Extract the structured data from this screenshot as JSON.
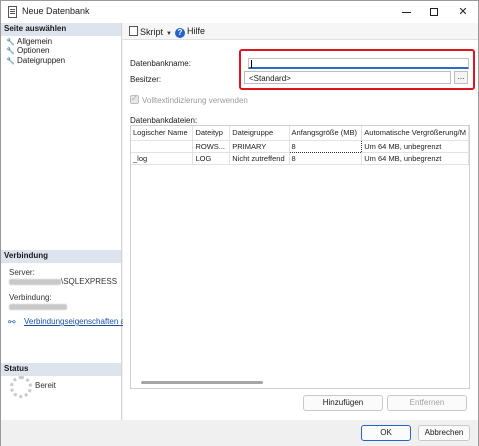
{
  "window": {
    "title": "Neue Datenbank"
  },
  "left_panel": {
    "select_page_header": "Seite auswählen",
    "pages": [
      {
        "label": "Allgemein"
      },
      {
        "label": "Optionen"
      },
      {
        "label": "Dateigruppen"
      }
    ],
    "connection_header": "Verbindung",
    "server_label": "Server:",
    "server_value_visible": "\\SQLEXPRESS",
    "connection_label": "Verbindung:",
    "connection_properties_link": "Verbindungseigenschaften an",
    "status_header": "Status",
    "status_value": "Bereit"
  },
  "toolbar": {
    "script_label": "Skript",
    "help_label": "Hilfe"
  },
  "form": {
    "db_name_label": "Datenbankname:",
    "db_name_value": "",
    "owner_label": "Besitzer:",
    "owner_value": "<Standard>",
    "owner_browse_label": "...",
    "fulltext_label": "Volltextindizierung verwenden",
    "files_label": "Datenbankdateien:"
  },
  "files_table": {
    "columns": [
      "Logischer Name",
      "Dateityp",
      "Dateigruppe",
      "Anfangsgröße (MB)",
      "Automatische Vergrößerung/M"
    ],
    "rows": [
      [
        "",
        "ROWS...",
        "PRIMARY",
        "8",
        "Um 64 MB, unbegrenzt"
      ],
      [
        "_log",
        "LOG",
        "Nicht zutreffend",
        "8",
        "Um 64 MB, unbegrenzt"
      ]
    ]
  },
  "buttons": {
    "add": "Hinzufügen",
    "remove": "Entfernen",
    "ok": "OK",
    "cancel": "Abbrechen"
  },
  "colors": {
    "highlight": "#e0141b",
    "accent": "#2e6bc6",
    "section_header": "#dde4ee"
  }
}
